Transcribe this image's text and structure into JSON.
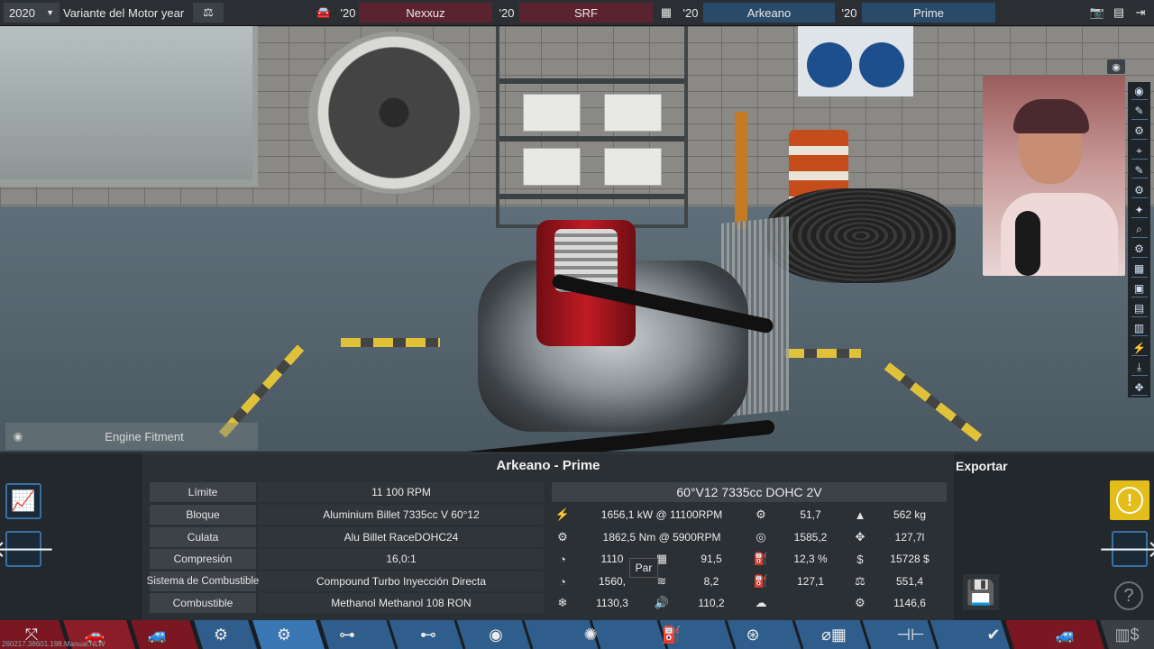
{
  "topbar": {
    "year": "2020",
    "variant_label": "Variante del Motor year",
    "car_model_year": "'20",
    "car_model": "Nexxuz",
    "car_trim_year": "'20",
    "car_trim": "SRF",
    "engine_family_year": "'20",
    "engine_family": "Arkeano",
    "engine_variant_year": "'20",
    "engine_variant": "Prime",
    "colors": {
      "red": "#5b2330",
      "blue": "#2a4a6a"
    }
  },
  "scene": {
    "fitment_label": "Engine Fitment"
  },
  "panel": {
    "title": "Arkeano - Prime",
    "export_label": "Exportar",
    "specs": [
      {
        "label": "Límite",
        "value": "11 100 RPM"
      },
      {
        "label": "Bloque",
        "value": "Aluminium Billet 7335cc V 60°12"
      },
      {
        "label": "Culata",
        "value": "Alu Billet RaceDOHC24"
      },
      {
        "label": "Compresión",
        "value": "16,0:1"
      },
      {
        "label": "Sistema de Combustible",
        "value": "Compound Turbo Inyección Directa"
      },
      {
        "label": "Combustible",
        "value": "Methanol Methanol 108 RON"
      }
    ],
    "engine_desc": "60°V12 7335cc DOHC 2V",
    "stats": [
      [
        "1656,1 kW @ 11100RPM",
        "51,7",
        "562 kg"
      ],
      [
        "1862,5 Nm @ 5900RPM",
        "1585,2",
        "127,7l"
      ],
      [
        "1110",
        "91,5",
        "12,3 %",
        "15728 $"
      ],
      [
        "1560,",
        "8,2",
        "127,1",
        "551,4"
      ],
      [
        "1130,3",
        "110,2",
        "",
        "1146,6"
      ]
    ],
    "tooltip": "Par",
    "warn_symbol": "!",
    "help_symbol": "?"
  },
  "build_text": "260217.38601.198.Manual.NLW",
  "accent_color": "#e3bd19"
}
